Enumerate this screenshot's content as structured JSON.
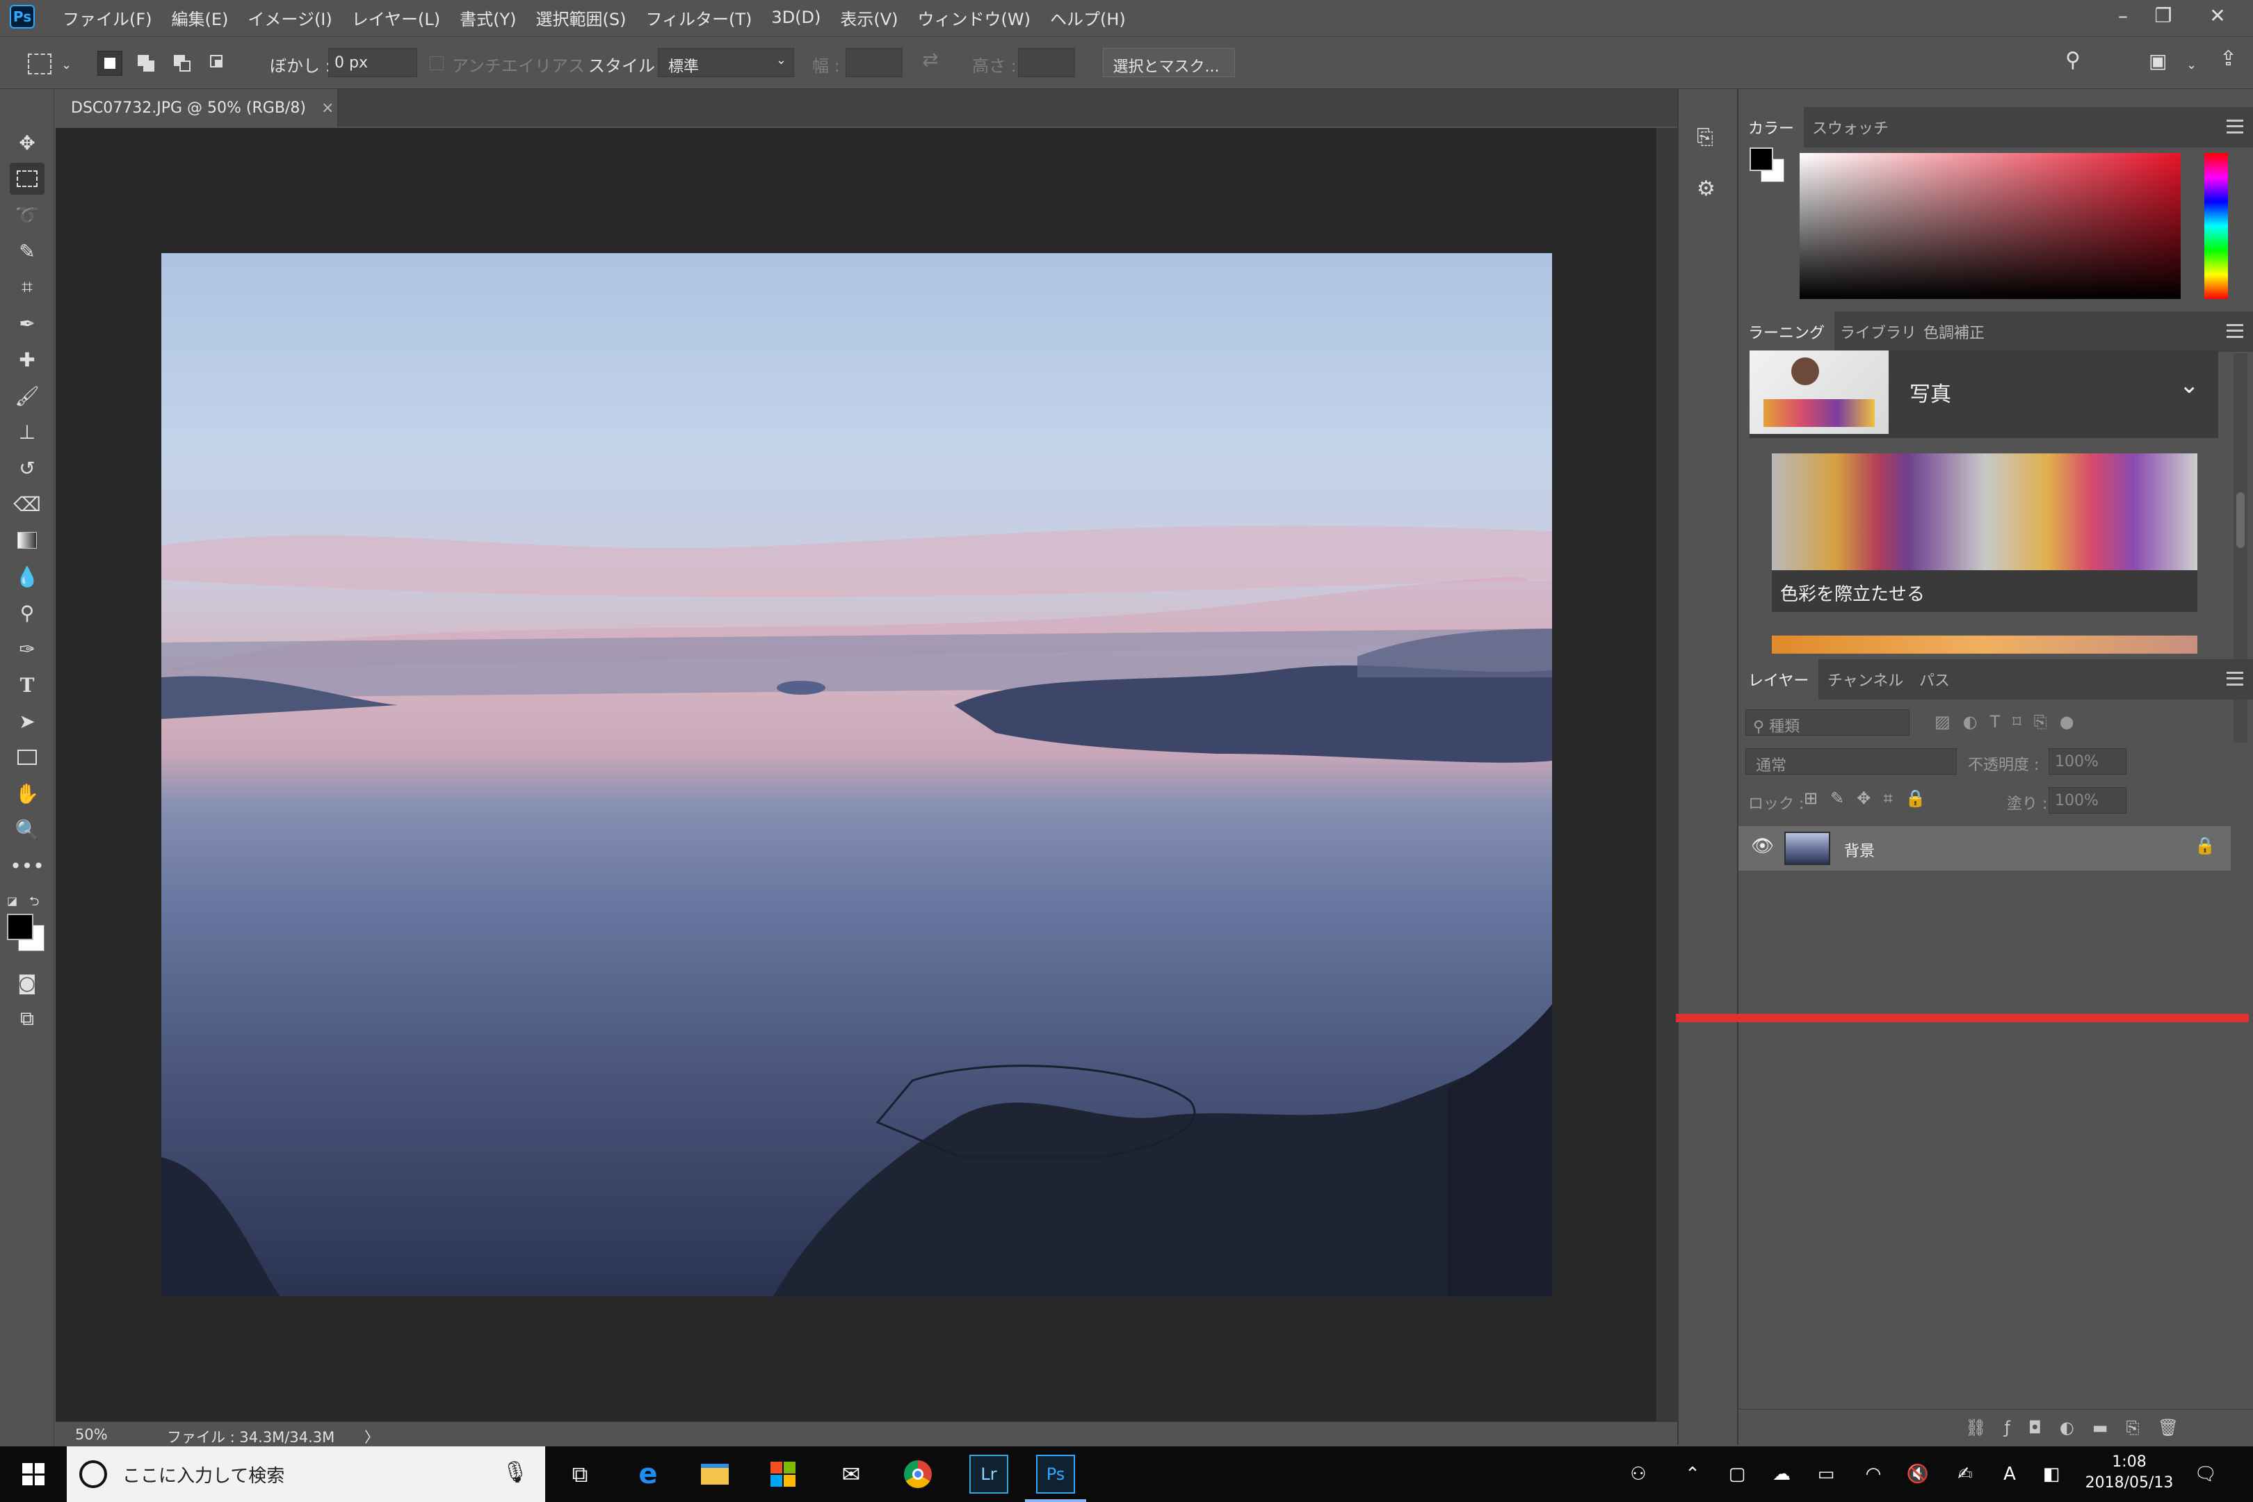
{
  "app": {
    "logo": "Ps"
  },
  "menu": [
    "ファイル(F)",
    "編集(E)",
    "イメージ(I)",
    "レイヤー(L)",
    "書式(Y)",
    "選択範囲(S)",
    "フィルター(T)",
    "3D(D)",
    "表示(V)",
    "ウィンドウ(W)",
    "ヘルプ(H)"
  ],
  "options": {
    "feather_label": "ぼかし :",
    "feather_value": "0 px",
    "antialias_label": "アンチエイリアス",
    "style_label": "スタイル :",
    "style_value": "標準",
    "width_label": "幅 :",
    "height_label": "高さ :",
    "select_mask_label": "選択とマスク..."
  },
  "document": {
    "tab_title": "DSC07732.JPG @ 50% (RGB/8)",
    "close": "×"
  },
  "status": {
    "zoom": "50%",
    "file_info": "ファイル : 34.3M/34.3M",
    "arrow": "〉"
  },
  "color_panel": {
    "tabs": [
      "カラー",
      "スウォッチ"
    ]
  },
  "learn_panel": {
    "tabs": [
      "ラーニング",
      "ライブラリ",
      "色調補正"
    ],
    "section_title": "写真",
    "card_title": "色彩を際立たせる"
  },
  "layers_panel": {
    "tabs": [
      "レイヤー",
      "チャンネル",
      "パス"
    ],
    "filter_placeholder": "種類",
    "blend_mode": "通常",
    "opacity_label": "不透明度 :",
    "opacity_value": "100%",
    "lock_label": "ロック :",
    "fill_label": "塗り :",
    "fill_value": "100%",
    "layers": [
      {
        "name": "背景"
      }
    ]
  },
  "taskbar": {
    "search_placeholder": "ここに入力して検索",
    "time": "1:08",
    "date": "2018/05/13",
    "lr_label": "Lr",
    "ps_label": "Ps",
    "ime_label": "A"
  }
}
